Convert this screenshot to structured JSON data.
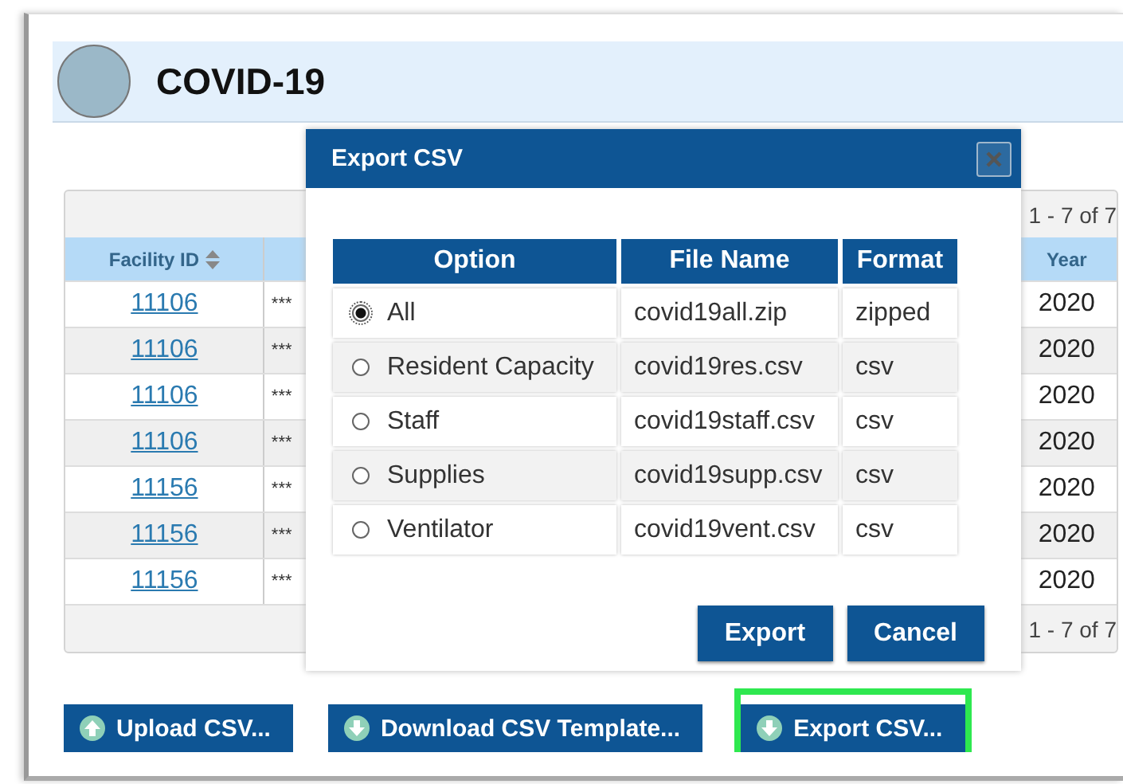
{
  "header": {
    "title": "COVID-19"
  },
  "grid": {
    "pager_top": "1 - 7 of 7",
    "pager_bottom": "1 - 7 of 7",
    "columns": [
      {
        "label": "Facility ID",
        "sortable": true
      },
      {
        "label": "Year",
        "sortable": false
      }
    ],
    "rows": [
      {
        "facility_id": "11106",
        "column_2": "***",
        "year": "2020"
      },
      {
        "facility_id": "11106",
        "column_2": "***",
        "year": "2020"
      },
      {
        "facility_id": "11106",
        "column_2": "***",
        "year": "2020"
      },
      {
        "facility_id": "11106",
        "column_2": "***",
        "year": "2020"
      },
      {
        "facility_id": "11156",
        "column_2": "***",
        "year": "2020"
      },
      {
        "facility_id": "11156",
        "column_2": "***",
        "year": "2020"
      },
      {
        "facility_id": "11156",
        "column_2": "***",
        "year": "2020"
      }
    ]
  },
  "dialog": {
    "title": "Export CSV",
    "columns": [
      "Option",
      "File Name",
      "Format"
    ],
    "rows": [
      {
        "option": "All",
        "selected": true,
        "file_name": "covid19all.zip",
        "format": "zipped"
      },
      {
        "option": "Resident Capacity",
        "selected": false,
        "file_name": "covid19res.csv",
        "format": "csv"
      },
      {
        "option": "Staff",
        "selected": false,
        "file_name": "covid19staff.csv",
        "format": "csv"
      },
      {
        "option": "Supplies",
        "selected": false,
        "file_name": "covid19supp.csv",
        "format": "csv"
      },
      {
        "option": "Ventilator",
        "selected": false,
        "file_name": "covid19vent.csv",
        "format": "csv"
      }
    ],
    "buttons": [
      "Export",
      "Cancel"
    ]
  },
  "actions": [
    {
      "label": "Upload CSV...",
      "kind": "upload",
      "highlighted": false
    },
    {
      "label": "Download CSV Template...",
      "kind": "download",
      "highlighted": false
    },
    {
      "label": "Export CSV...",
      "kind": "download",
      "highlighted": true
    }
  ]
}
